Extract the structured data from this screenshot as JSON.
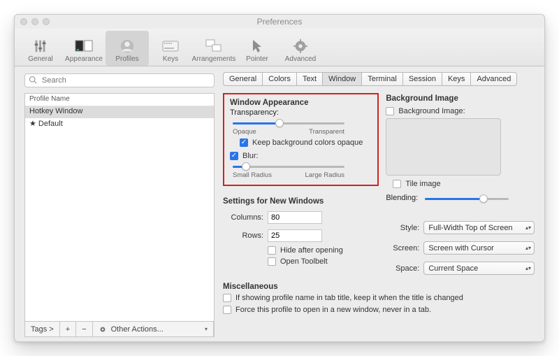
{
  "title": "Preferences",
  "toolbar": [
    {
      "label": "General"
    },
    {
      "label": "Appearance"
    },
    {
      "label": "Profiles"
    },
    {
      "label": "Keys"
    },
    {
      "label": "Arrangements"
    },
    {
      "label": "Pointer"
    },
    {
      "label": "Advanced"
    }
  ],
  "search": {
    "placeholder": "Search"
  },
  "list": {
    "header": "Profile Name",
    "rows": [
      "Hotkey Window",
      "★ Default"
    ]
  },
  "bottombar": {
    "tags": "Tags >",
    "plus": "+",
    "minus": "−",
    "other": "Other Actions..."
  },
  "tabs": [
    "General",
    "Colors",
    "Text",
    "Window",
    "Terminal",
    "Session",
    "Keys",
    "Advanced"
  ],
  "tab_active": "Window",
  "appearance": {
    "title": "Window Appearance",
    "transparency_label": "Transparency:",
    "opaque": "Opaque",
    "transparent": "Transparent",
    "keep_opaque": "Keep background colors opaque",
    "blur_label": "Blur:",
    "small_radius": "Small Radius",
    "large_radius": "Large Radius"
  },
  "newwin": {
    "title": "Settings for New Windows",
    "columns_label": "Columns:",
    "columns_val": "80",
    "rows_label": "Rows:",
    "rows_val": "25",
    "hide": "Hide after opening",
    "toolbelt": "Open Toolbelt"
  },
  "misc": {
    "title": "Miscellaneous",
    "opt1": "If showing profile name in tab title, keep it when the title is changed",
    "opt2": "Force this profile to open in a new window, never in a tab."
  },
  "bg": {
    "title": "Background Image",
    "checkbox": "Background Image:",
    "tile": "Tile image",
    "blending": "Blending:"
  },
  "style": {
    "label": "Style:",
    "value": "Full-Width Top of Screen"
  },
  "screen": {
    "label": "Screen:",
    "value": "Screen with Cursor"
  },
  "space": {
    "label": "Space:",
    "value": "Current Space"
  }
}
